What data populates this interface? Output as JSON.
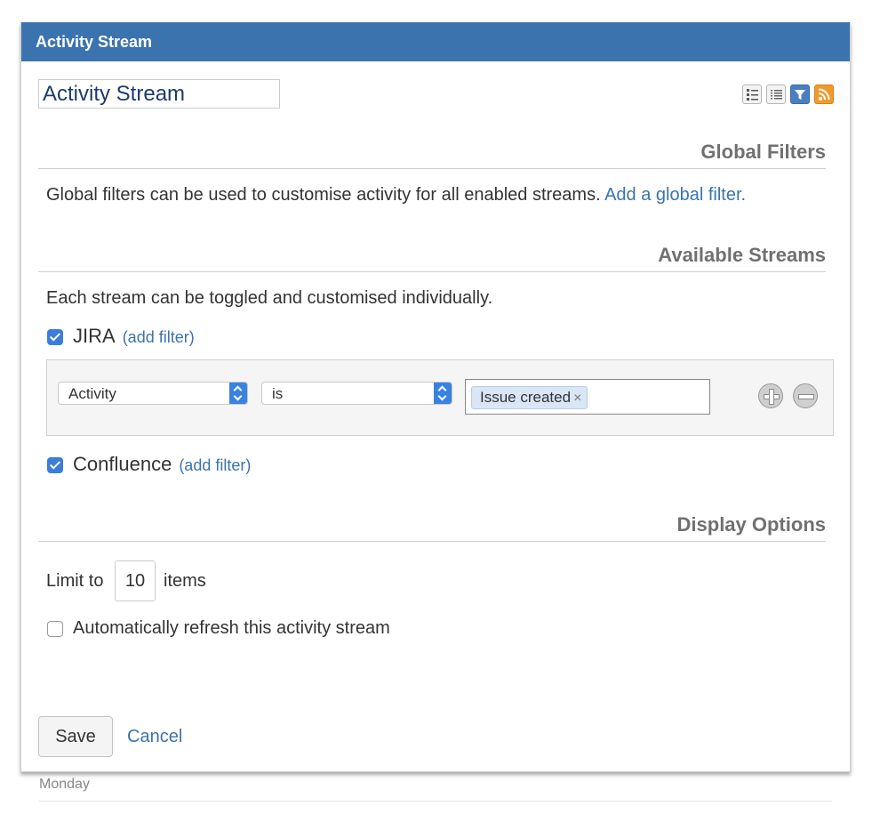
{
  "header": {
    "title": "Activity Stream"
  },
  "title_field": {
    "value": "Activity Stream"
  },
  "view_icons": [
    "detail-view-icon",
    "list-view-icon",
    "filter-icon",
    "rss-feed-icon"
  ],
  "global_filters": {
    "heading": "Global Filters",
    "description": "Global filters can be used to customise activity for all enabled streams.",
    "add_link": "Add a global filter."
  },
  "available_streams": {
    "heading": "Available Streams",
    "description": "Each stream can be toggled and customised individually.",
    "streams": [
      {
        "name": "JIRA",
        "checked": true,
        "add_filter": "(add filter)"
      },
      {
        "name": "Confluence",
        "checked": true,
        "add_filter": "(add filter)"
      }
    ],
    "filter_row": {
      "field": "Activity",
      "operator": "is",
      "value_tag": "Issue created",
      "remove_tag": "×"
    }
  },
  "display_options": {
    "heading": "Display Options",
    "limit_prefix": "Limit to",
    "limit_value": "10",
    "limit_suffix": "items",
    "auto_refresh_label": "Automatically refresh this activity stream",
    "auto_refresh_checked": false
  },
  "actions": {
    "save": "Save",
    "cancel": "Cancel"
  },
  "feed": {
    "day_label": "Monday"
  },
  "colors": {
    "header_bg": "#3b73af",
    "link": "#3b73af",
    "checkbox": "#3b7ddd",
    "rss": "#f19a2c"
  }
}
